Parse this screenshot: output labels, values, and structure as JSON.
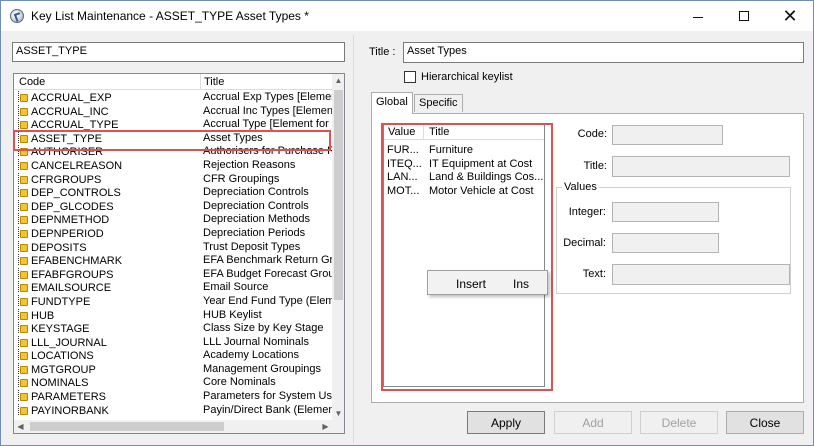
{
  "window": {
    "title": "Key List Maintenance - ASSET_TYPE Asset Types *",
    "minimize_glyph": "—",
    "maximize_glyph": "☐",
    "close_glyph": "✕"
  },
  "left": {
    "search_value": "ASSET_TYPE",
    "columns": {
      "code": "Code",
      "title": "Title"
    },
    "rows": [
      {
        "code": "ACCRUAL_EXP",
        "title": "Accrual Exp Types [Elemen"
      },
      {
        "code": "ACCRUAL_INC",
        "title": "Accrual Inc Types [Elemen"
      },
      {
        "code": "ACCRUAL_TYPE",
        "title": "Accrual Type [Element for"
      },
      {
        "code": "ASSET_TYPE",
        "title": "Asset Types"
      },
      {
        "code": "AUTHORISER",
        "title": "Authorisers for Purchase R"
      },
      {
        "code": "CANCELREASON",
        "title": "Rejection Reasons"
      },
      {
        "code": "CFRGROUPS",
        "title": "CFR Groupings"
      },
      {
        "code": "DEP_CONTROLS",
        "title": "Depreciation Controls"
      },
      {
        "code": "DEP_GLCODES",
        "title": "Depreciation Controls"
      },
      {
        "code": "DEPNMETHOD",
        "title": "Depreciation Methods"
      },
      {
        "code": "DEPNPERIOD",
        "title": "Depreciation Periods"
      },
      {
        "code": "DEPOSITS",
        "title": "Trust Deposit Types"
      },
      {
        "code": "EFABENCHMARK",
        "title": "EFA Benchmark Return Gr"
      },
      {
        "code": "EFABFGROUPS",
        "title": "EFA Budget Forecast Grou"
      },
      {
        "code": "EMAILSOURCE",
        "title": "Email Source"
      },
      {
        "code": "FUNDTYPE",
        "title": "Year End Fund Type (Elem"
      },
      {
        "code": "HUB",
        "title": "HUB Keylist"
      },
      {
        "code": "KEYSTAGE",
        "title": "Class Size by Key Stage"
      },
      {
        "code": "LLL_JOURNAL",
        "title": "LLL Journal Nominals"
      },
      {
        "code": "LOCATIONS",
        "title": "Academy Locations"
      },
      {
        "code": "MGTGROUP",
        "title": "Management Groupings"
      },
      {
        "code": "NOMINALS",
        "title": "Core Nominals"
      },
      {
        "code": "PARAMETERS",
        "title": "Parameters for System Us"
      },
      {
        "code": "PAYINORBANK",
        "title": "Payin/Direct Bank (Elemen"
      }
    ],
    "selected_index": 3
  },
  "right": {
    "title_label": "Title :",
    "title_value": "Asset Types",
    "hierarchical_label": "Hierarchical keylist",
    "hierarchical_checked": false,
    "tabs": [
      {
        "label": "Global",
        "active": true
      },
      {
        "label": "Specific",
        "active": false
      }
    ],
    "values_list": {
      "columns": {
        "value": "Value",
        "title": "Title"
      },
      "rows": [
        {
          "value": "FUR...",
          "title": "Furniture"
        },
        {
          "value": "ITEQ...",
          "title": "IT Equipment at Cost"
        },
        {
          "value": "LAN...",
          "title": "Land & Buildings Cos..."
        },
        {
          "value": "MOT...",
          "title": "Motor Vehicle at Cost"
        }
      ]
    },
    "context_menu": {
      "item": "Insert",
      "shortcut": "Ins"
    },
    "fields": {
      "code_label": "Code:",
      "code_value": "",
      "title_label": "Title:",
      "title_value": "",
      "values_group": "Values",
      "integer_label": "Integer:",
      "integer_value": "",
      "decimal_label": "Decimal:",
      "decimal_value": "",
      "text_label": "Text:",
      "text_value": ""
    },
    "buttons": {
      "apply": "Apply",
      "add": "Add",
      "delete": "Delete",
      "close": "Close"
    }
  }
}
